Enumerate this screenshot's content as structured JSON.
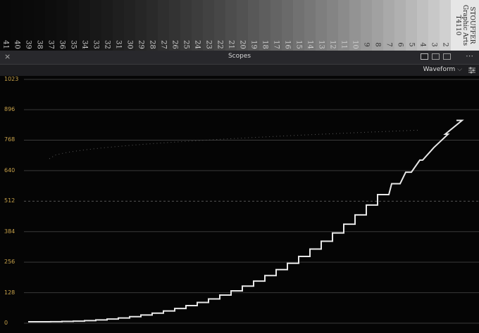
{
  "wedge": {
    "steps": [
      "41",
      "40",
      "39",
      "38",
      "37",
      "36",
      "35",
      "34",
      "33",
      "32",
      "31",
      "30",
      "29",
      "28",
      "27",
      "26",
      "25",
      "24",
      "23",
      "22",
      "21",
      "20",
      "19",
      "18",
      "17",
      "16",
      "15",
      "14",
      "13",
      "12",
      "11",
      "10",
      "9",
      "8",
      "7",
      "6",
      "5",
      "4",
      "3",
      "2"
    ],
    "label_lines": [
      "STOUFFER",
      "Graphic Arts",
      "T4110"
    ]
  },
  "panel": {
    "title": "Scopes",
    "close_glyph": "×",
    "mode": "Waveform",
    "mode_caret": "⌵",
    "settings_icon": "sliders-icon",
    "more_glyph": "⋯"
  },
  "scale": {
    "labels": [
      "1023",
      "896",
      "768",
      "640",
      "512",
      "384",
      "256",
      "128",
      "0"
    ],
    "values": [
      1023,
      896,
      768,
      640,
      512,
      384,
      256,
      128,
      0
    ],
    "label_color": "#c8a24a"
  }
}
